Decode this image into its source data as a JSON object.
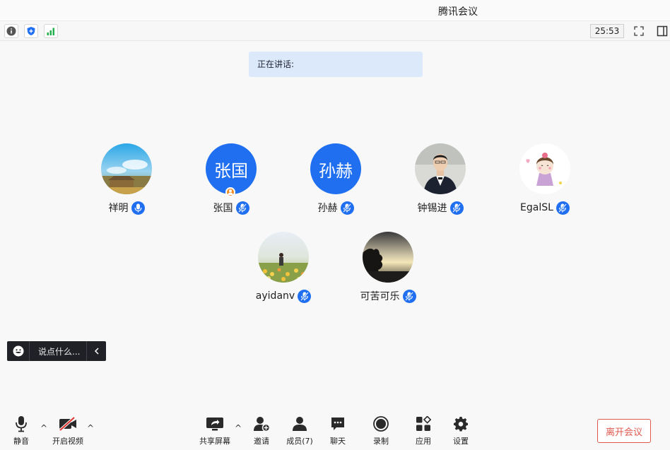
{
  "window": {
    "title": "腾讯会议"
  },
  "statusbar": {
    "timer": "25:53"
  },
  "speaking": {
    "label": "正在讲话:"
  },
  "participants": [
    {
      "name": "祥明"
    },
    {
      "name": "张国",
      "avatar_text": "张国",
      "host": true
    },
    {
      "name": "孙赫",
      "avatar_text": "孙赫"
    },
    {
      "name": "钟锡进"
    },
    {
      "name": "EgalSL"
    },
    {
      "name": "ayidanv"
    },
    {
      "name": "可苦可乐"
    }
  ],
  "chat": {
    "placeholder": "说点什么..."
  },
  "toolbar": {
    "mute": "静音",
    "video": "开启视频",
    "share": "共享屏幕",
    "invite": "邀请",
    "members": "成员(7)",
    "chat": "聊天",
    "record": "录制",
    "apps": "应用",
    "settings": "设置",
    "leave": "离开会议"
  },
  "colors": {
    "accent": "#1f6ff0",
    "leave": "#e0594f",
    "speaking_bg": "#dbe9fb"
  }
}
